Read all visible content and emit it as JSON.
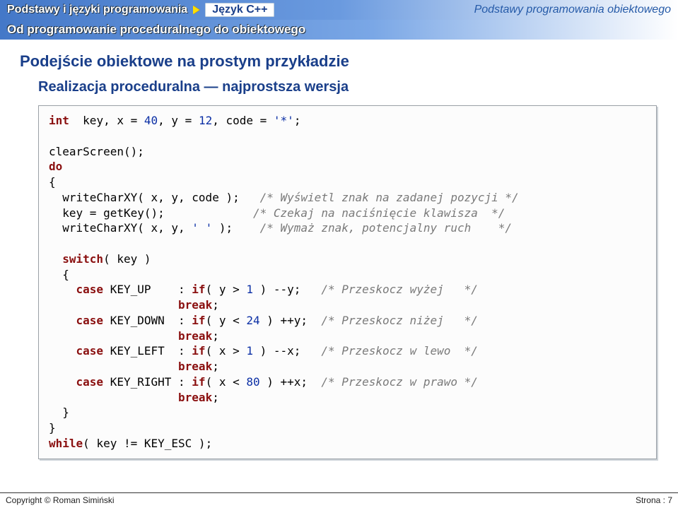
{
  "header": {
    "breadcrumb": "Podstawy i języki programowania",
    "language_badge": "Język C++",
    "topic_right": "Podstawy programowania obiektowego",
    "section": "Od programowanie proceduralnego do obiektowego"
  },
  "headings": {
    "main": "Podejście obiektowe na prostym przykładzie",
    "sub": "Realizacja proceduralna — najprostsza wersja"
  },
  "code": {
    "kw_int": "int",
    "decl_rest": "  key, x = ",
    "n40": "40",
    "decl_mid": ", y = ",
    "n12": "12",
    "decl_end": ", code = ",
    "scharstar": "'*'",
    "semicolon": ";",
    "clearscreen": "clearScreen();",
    "kw_do": "do",
    "lbrace": "{",
    "rbrace": "}",
    "write1_call": "  writeCharXY( x, y, code );",
    "write1_cmt": "   /* Wyświetl znak na zadanej pozycji */",
    "getkey_call": "  key = getKey();",
    "getkey_cmt": "             /* Czekaj na naciśnięcie klawisza  */",
    "write2_call": "  writeCharXY( x, y, ",
    "space_char": "' '",
    "write2_tail": " );",
    "write2_cmt": "    /* Wymaż znak, potencjalny ruch    */",
    "kw_switch": "switch",
    "switch_tail": "( key )",
    "kw_case": "case",
    "kw_if": "if",
    "kw_break": "break",
    "up_label": " KEY_UP    : ",
    "up_cond": "( y > ",
    "n1a": "1",
    "up_cond2": " ) --y;",
    "up_cmt": "   /* Przeskocz wyżej   */",
    "down_label": " KEY_DOWN  : ",
    "down_cond": "( y < ",
    "n24": "24",
    "down_cond2": " ) ++y;",
    "down_cmt": "  /* Przeskocz niżej   */",
    "left_label": " KEY_LEFT  : ",
    "left_cond": "( x > ",
    "n1b": "1",
    "left_cond2": " ) --x;",
    "left_cmt": "   /* Przeskocz w lewo  */",
    "right_label": " KEY_RIGHT : ",
    "right_cond": "( x < ",
    "n80": "80",
    "right_cond2": " ) ++x;",
    "right_cmt": "  /* Przeskocz w prawo */",
    "break_line": "                   ",
    "kw_while": "while",
    "while_tail": "( key != KEY_ESC );"
  },
  "footer": {
    "left": "Copyright © Roman Simiński",
    "right": "Strona : 7"
  }
}
